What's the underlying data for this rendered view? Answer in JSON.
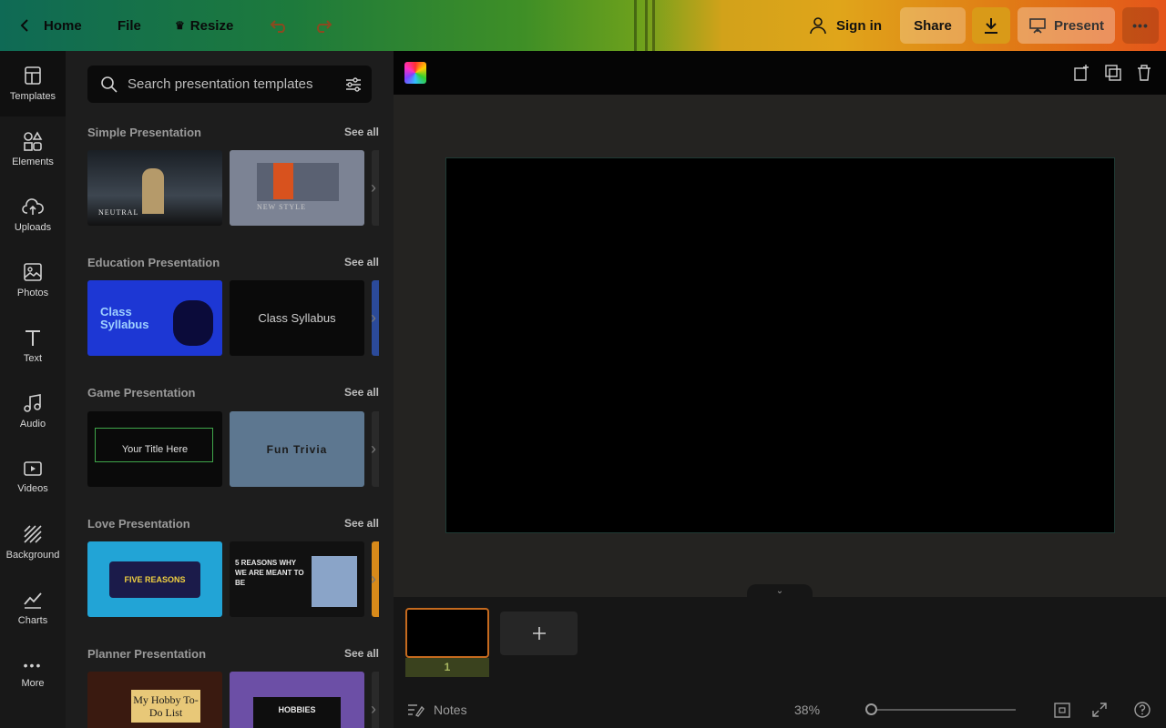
{
  "topbar": {
    "home_label": "Home",
    "file_label": "File",
    "resize_label": "Resize",
    "sign_in_label": "Sign in",
    "share_label": "Share",
    "present_label": "Present"
  },
  "rail": {
    "items": [
      {
        "label": "Templates",
        "icon": "templates-icon"
      },
      {
        "label": "Elements",
        "icon": "elements-icon"
      },
      {
        "label": "Uploads",
        "icon": "upload-cloud-icon"
      },
      {
        "label": "Photos",
        "icon": "image-icon"
      },
      {
        "label": "Text",
        "icon": "text-icon"
      },
      {
        "label": "Audio",
        "icon": "music-note-icon"
      },
      {
        "label": "Videos",
        "icon": "video-icon"
      },
      {
        "label": "Background",
        "icon": "hatch-icon"
      },
      {
        "label": "Charts",
        "icon": "chart-line-icon"
      },
      {
        "label": "More",
        "icon": "more-dots-icon"
      }
    ]
  },
  "panel": {
    "search_placeholder": "Search presentation templates",
    "see_all_label": "See all",
    "sections": [
      {
        "title": "Simple Presentation",
        "thumbs": [
          "NEUTRAL",
          "NEW STYLE"
        ]
      },
      {
        "title": "Education Presentation",
        "thumbs": [
          "Class Syllabus",
          "Class Syllabus"
        ]
      },
      {
        "title": "Game Presentation",
        "thumbs": [
          "Your Title Here",
          "Fun Trivia"
        ]
      },
      {
        "title": "Love Presentation",
        "thumbs": [
          "FIVE REASONS",
          "5 REASONS WHY WE ARE MEANT TO BE"
        ]
      },
      {
        "title": "Planner Presentation",
        "thumbs": [
          "My Hobby To-Do List",
          "HOBBIES"
        ]
      }
    ]
  },
  "filmstrip": {
    "page_number": "1"
  },
  "footer": {
    "notes_label": "Notes",
    "zoom_value": "38%"
  },
  "colors": {
    "accent_orange": "#c56a1e",
    "page_label_bg": "#3a421e"
  }
}
